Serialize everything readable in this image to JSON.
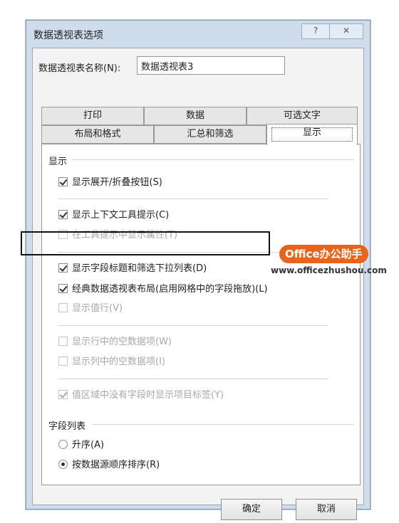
{
  "window": {
    "title": "数据透视表选项",
    "help_label": "?",
    "close_label": "✕"
  },
  "name_field": {
    "label": "数据透视表名称(N):",
    "value": "数据透视表3"
  },
  "tabs": {
    "row1": [
      "打印",
      "数据",
      "可选文字"
    ],
    "row2": [
      "布局和格式",
      "汇总和筛选",
      "显示"
    ],
    "active": "显示"
  },
  "display_section": {
    "header": "显示",
    "options": [
      {
        "label": "显示展开/折叠按钮(S)",
        "checked": true,
        "enabled": true
      },
      {
        "label": "显示上下文工具提示(C)",
        "checked": true,
        "enabled": true
      },
      {
        "label": "在工具提示中显示属性(T)",
        "checked": false,
        "enabled": false
      },
      {
        "label": "显示字段标题和筛选下拉列表(D)",
        "checked": true,
        "enabled": true
      },
      {
        "label": "经典数据透视表布局(启用网格中的字段拖放)(L)",
        "checked": true,
        "enabled": true
      },
      {
        "label": "显示值行(V)",
        "checked": false,
        "enabled": false
      },
      {
        "label": "显示行中的空数据项(W)",
        "checked": false,
        "enabled": false
      },
      {
        "label": "显示列中的空数据项(I)",
        "checked": false,
        "enabled": false
      },
      {
        "label": "值区域中没有字段时显示项目标签(Y)",
        "checked": true,
        "enabled": false
      }
    ]
  },
  "field_list_section": {
    "header": "字段列表",
    "options": [
      {
        "label": "升序(A)",
        "selected": false
      },
      {
        "label": "按数据源顺序排序(R)",
        "selected": true
      }
    ]
  },
  "buttons": {
    "ok": "确定",
    "cancel": "取消"
  },
  "watermark": {
    "badge": "Office办公助手",
    "url": "www.officezhushou.com",
    "color": "#e8641b"
  }
}
